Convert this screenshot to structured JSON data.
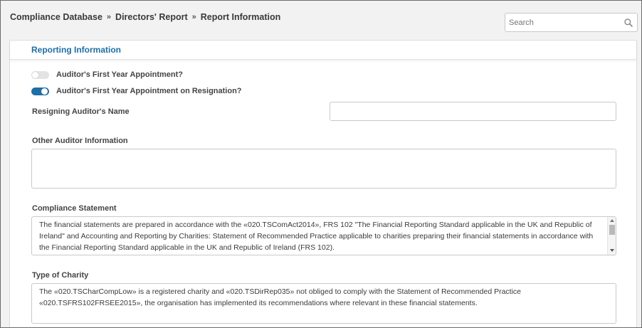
{
  "breadcrumb": {
    "items": [
      "Compliance Database",
      "Directors' Report",
      "Report Information"
    ],
    "separator": "»"
  },
  "search": {
    "placeholder": "Search",
    "value": ""
  },
  "panel": {
    "title": "Reporting Information"
  },
  "toggles": [
    {
      "label": "Auditor's First Year Appointment?",
      "state": "off"
    },
    {
      "label": "Auditor's First Year Appointment on Resignation?",
      "state": "on"
    }
  ],
  "fields": {
    "resigning_auditor": {
      "label": "Resigning Auditor's Name",
      "value": ""
    },
    "other_auditor_info": {
      "label": "Other Auditor Information",
      "value": ""
    },
    "compliance_statement": {
      "label": "Compliance Statement",
      "value": "The financial statements are prepared in accordance with the «020.TSComAct2014», FRS 102 \"The Financial Reporting Standard applicable in the UK and Republic of Ireland\" and Accounting and Reporting by Charities: Statement of Recommended Practice applicable to charities preparing their financial statements in accordance with the Financial Reporting Standard applicable in the UK and Republic of Ireland (FRS 102)."
    },
    "type_of_charity": {
      "label": "Type of Charity",
      "value": "The «020.TSCharCompLow» is a registered charity and «020.TSDirRep035» not obliged to comply with the Statement of Recommended Practice «020.TSFRS102FRSEE2015», the organisation has implemented its recommendations where relevant in these financial statements."
    }
  },
  "colors": {
    "accent": "#1f6ea5",
    "background": "#f2f2f2",
    "panel": "#ffffff"
  },
  "icons": {
    "search": "search-icon"
  }
}
